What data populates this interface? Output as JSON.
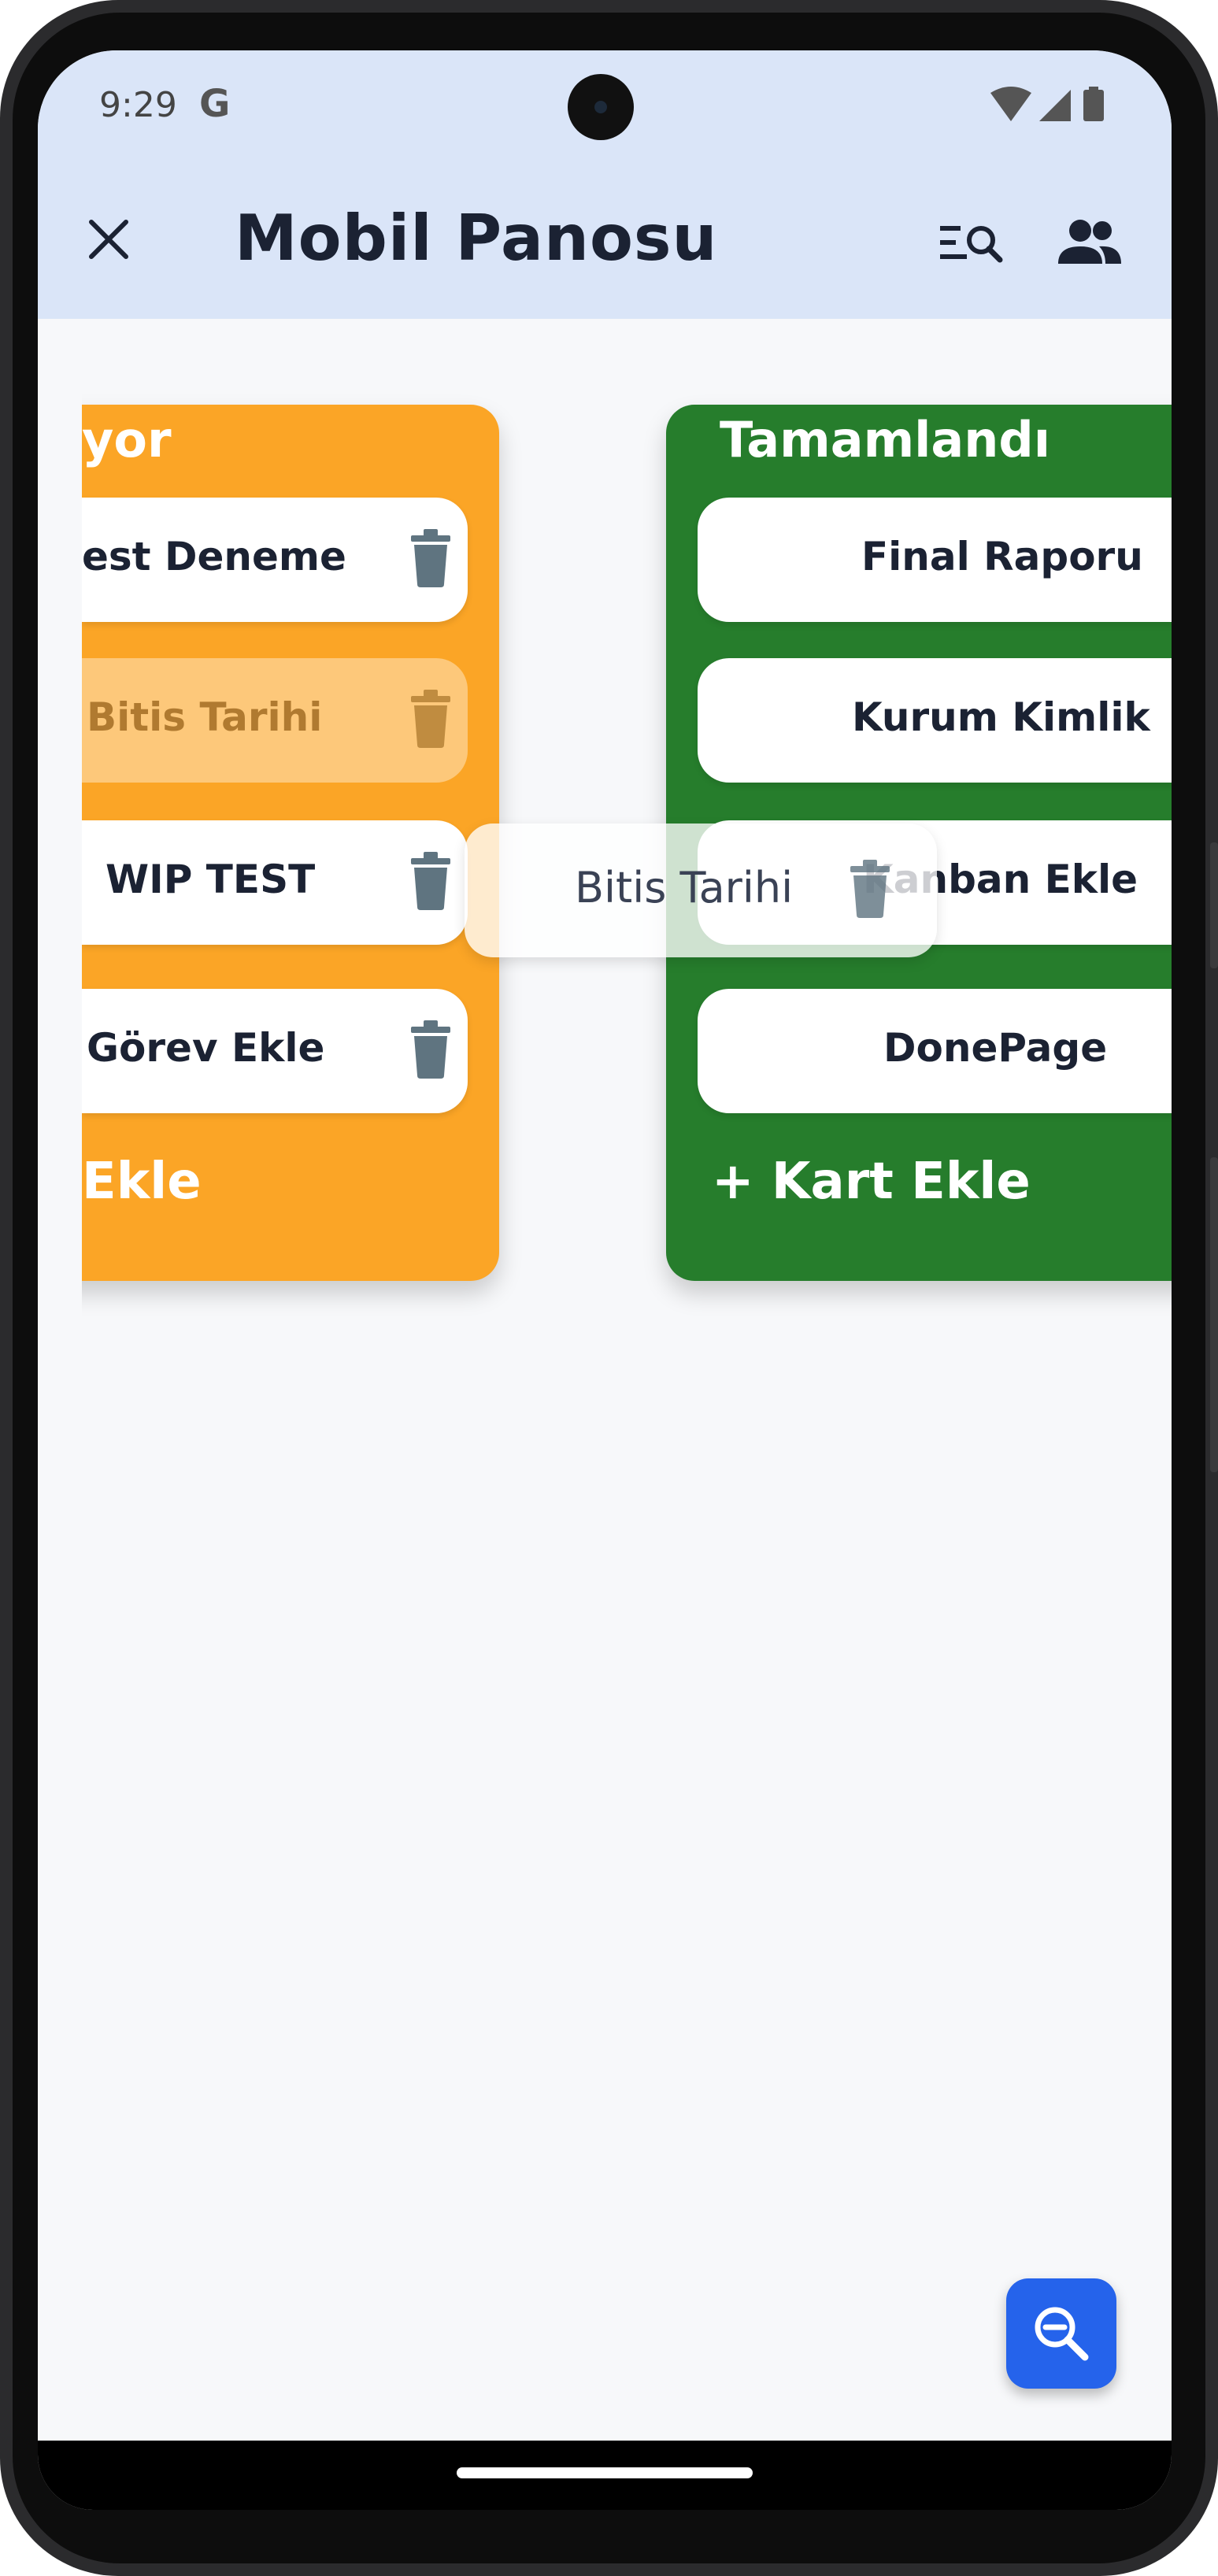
{
  "status_bar": {
    "time": "9:29",
    "google_glyph": "G",
    "icons": [
      "wifi-icon",
      "cell-signal-icon",
      "battery-icon"
    ]
  },
  "app_bar": {
    "close_icon": "close-icon",
    "title": "Mobil Panosu",
    "actions": [
      {
        "icon": "search-list-icon"
      },
      {
        "icon": "group-icon"
      }
    ]
  },
  "board": {
    "columns": [
      {
        "title": "yor",
        "color": "#fba526",
        "cards": [
          {
            "label": "est Deneme"
          },
          {
            "label": "Bitis Tarihi"
          },
          {
            "label": "WIP TEST"
          },
          {
            "label": "Görev Ekle"
          }
        ],
        "add_label": "Ekle"
      },
      {
        "title": "Tamamlandı",
        "color": "#267d2c",
        "cards": [
          {
            "label": "Final Raporu"
          },
          {
            "label": "Kurum Kimlik"
          },
          {
            "label": "Kanban Ekle"
          },
          {
            "label": "DonePage"
          }
        ],
        "add_label": "+ Kart Ekle"
      }
    ],
    "dragging_card": {
      "label": "Bitis Tarihi"
    }
  },
  "fab": {
    "icon": "zoom-out-icon"
  },
  "colors": {
    "appbar": "#dae5f8",
    "accent": "#2563eb",
    "trash": "#5f7480"
  }
}
